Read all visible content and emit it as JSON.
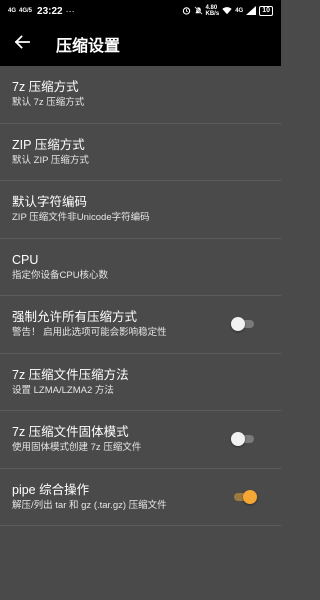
{
  "status_bar": {
    "net1": "4G",
    "net2": "4G/5",
    "time": "23:22",
    "dots": "···",
    "speed": "4.80",
    "speed_unit": "KB/s",
    "net3": "4G",
    "battery": "10"
  },
  "app_bar": {
    "back_icon": "arrow-left-icon",
    "title": "压缩设置"
  },
  "settings": [
    {
      "title": "7z 压缩方式",
      "subtitle": "默认 7z 压缩方式"
    },
    {
      "title": "ZIP 压缩方式",
      "subtitle": "默认 ZIP 压缩方式"
    },
    {
      "title": "默认字符编码",
      "subtitle": "ZIP 压缩文件非Unicode字符编码"
    },
    {
      "title": "CPU",
      "subtitle": "指定你设备CPU核心数"
    },
    {
      "title": "强制允许所有压缩方式",
      "subtitle": "警告！ 启用此选项可能会影响稳定性",
      "toggle": "off"
    },
    {
      "title": "7z 压缩文件压缩方法",
      "subtitle": "设置 LZMA/LZMA2 方法"
    },
    {
      "title": "7z 压缩文件固体模式",
      "subtitle": "使用固体模式创建 7z 压缩文件",
      "toggle": "off"
    },
    {
      "title": "pipe 综合操作",
      "subtitle": "解压/列出 tar 和 gz (.tar.gz) 压缩文件",
      "toggle": "on"
    }
  ],
  "colors": {
    "background": "#4a4a4a",
    "app_bar": "#000000",
    "accent": "#f6a634"
  }
}
